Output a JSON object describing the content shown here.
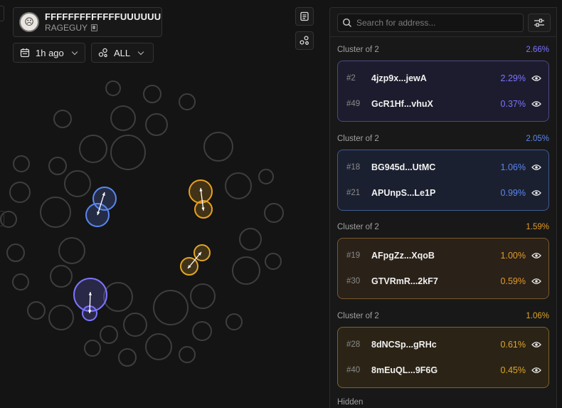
{
  "token": {
    "name": "FFFFFFFFFFFFFUUUUUUU...",
    "symbol": "RAGEGUY",
    "avatar_glyph": "☹"
  },
  "controls": {
    "time_label": "1h ago",
    "filter_label": "ALL"
  },
  "search": {
    "placeholder": "Search for address..."
  },
  "colors": {
    "purple": "#7b74ff",
    "blue": "#5b86f0",
    "orange": "#e8a020",
    "gold": "#e0a528",
    "bubble_gray": "#3e3e3e"
  },
  "clusters": [
    {
      "label": "Cluster of 2",
      "total": "2.66%",
      "accent": "#7b74ff",
      "box_bg": "#1d1c2e",
      "box_border": "#4c4788",
      "holders": [
        {
          "rank": "#2",
          "address": "4jzp9x...jewA",
          "percent": "2.29%"
        },
        {
          "rank": "#49",
          "address": "GcR1Hf...vhuX",
          "percent": "0.37%"
        }
      ]
    },
    {
      "label": "Cluster of 2",
      "total": "2.05%",
      "accent": "#5b86f0",
      "box_bg": "#1b2030",
      "box_border": "#3e5a92",
      "holders": [
        {
          "rank": "#18",
          "address": "BG945d...UtMC",
          "percent": "1.06%"
        },
        {
          "rank": "#21",
          "address": "APUnpS...Le1P",
          "percent": "0.99%"
        }
      ]
    },
    {
      "label": "Cluster of 2",
      "total": "1.59%",
      "accent": "#e39a2a",
      "box_bg": "#2a2118",
      "box_border": "#7a5a2c",
      "holders": [
        {
          "rank": "#19",
          "address": "AFpgZz...XqoB",
          "percent": "1.00%"
        },
        {
          "rank": "#30",
          "address": "GTVRmR...2kF7",
          "percent": "0.59%"
        }
      ]
    },
    {
      "label": "Cluster of 2",
      "total": "1.06%",
      "accent": "#e0a528",
      "box_bg": "#2b2416",
      "box_border": "#7a6428",
      "holders": [
        {
          "rank": "#28",
          "address": "8dNCSp...gRHc",
          "percent": "0.61%"
        },
        {
          "rank": "#40",
          "address": "8mEuQL...9F6G",
          "percent": "0.45%"
        }
      ]
    }
  ],
  "hidden_label": "Hidden",
  "icons": {
    "calendar": "calendar-icon",
    "bubbles": "bubbles-icon",
    "list": "list-icon",
    "nodes": "nodes-icon",
    "search": "search-icon",
    "filter": "sliders-icon",
    "eye": "eye-icon",
    "copy": "copy-icon"
  }
}
